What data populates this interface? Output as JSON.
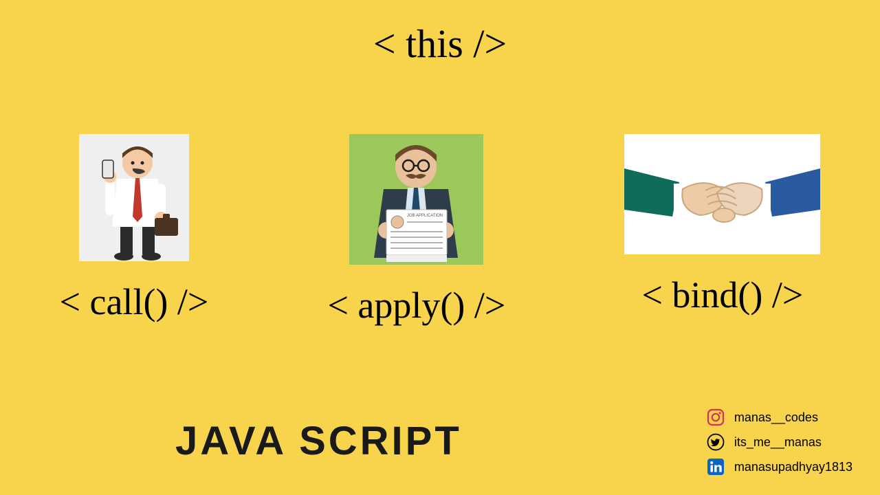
{
  "title": "< this />",
  "cards": [
    {
      "caption": "< call() />",
      "icon": "person-phone"
    },
    {
      "caption": "< apply() />",
      "icon": "job-application",
      "paper_text": "JOB APPLICATION"
    },
    {
      "caption": "< bind() />",
      "icon": "handshake"
    }
  ],
  "footer_title": "JAVA SCRIPT",
  "socials": [
    {
      "platform": "instagram",
      "handle": "manas__codes"
    },
    {
      "platform": "twitter",
      "handle": "its_me__manas"
    },
    {
      "platform": "linkedin",
      "handle": "manasupadhyay1813"
    }
  ],
  "colors": {
    "bg": "#f7d44b",
    "instagram_stroke": "#d62f5c",
    "linkedin_bg": "#0a66c2"
  }
}
